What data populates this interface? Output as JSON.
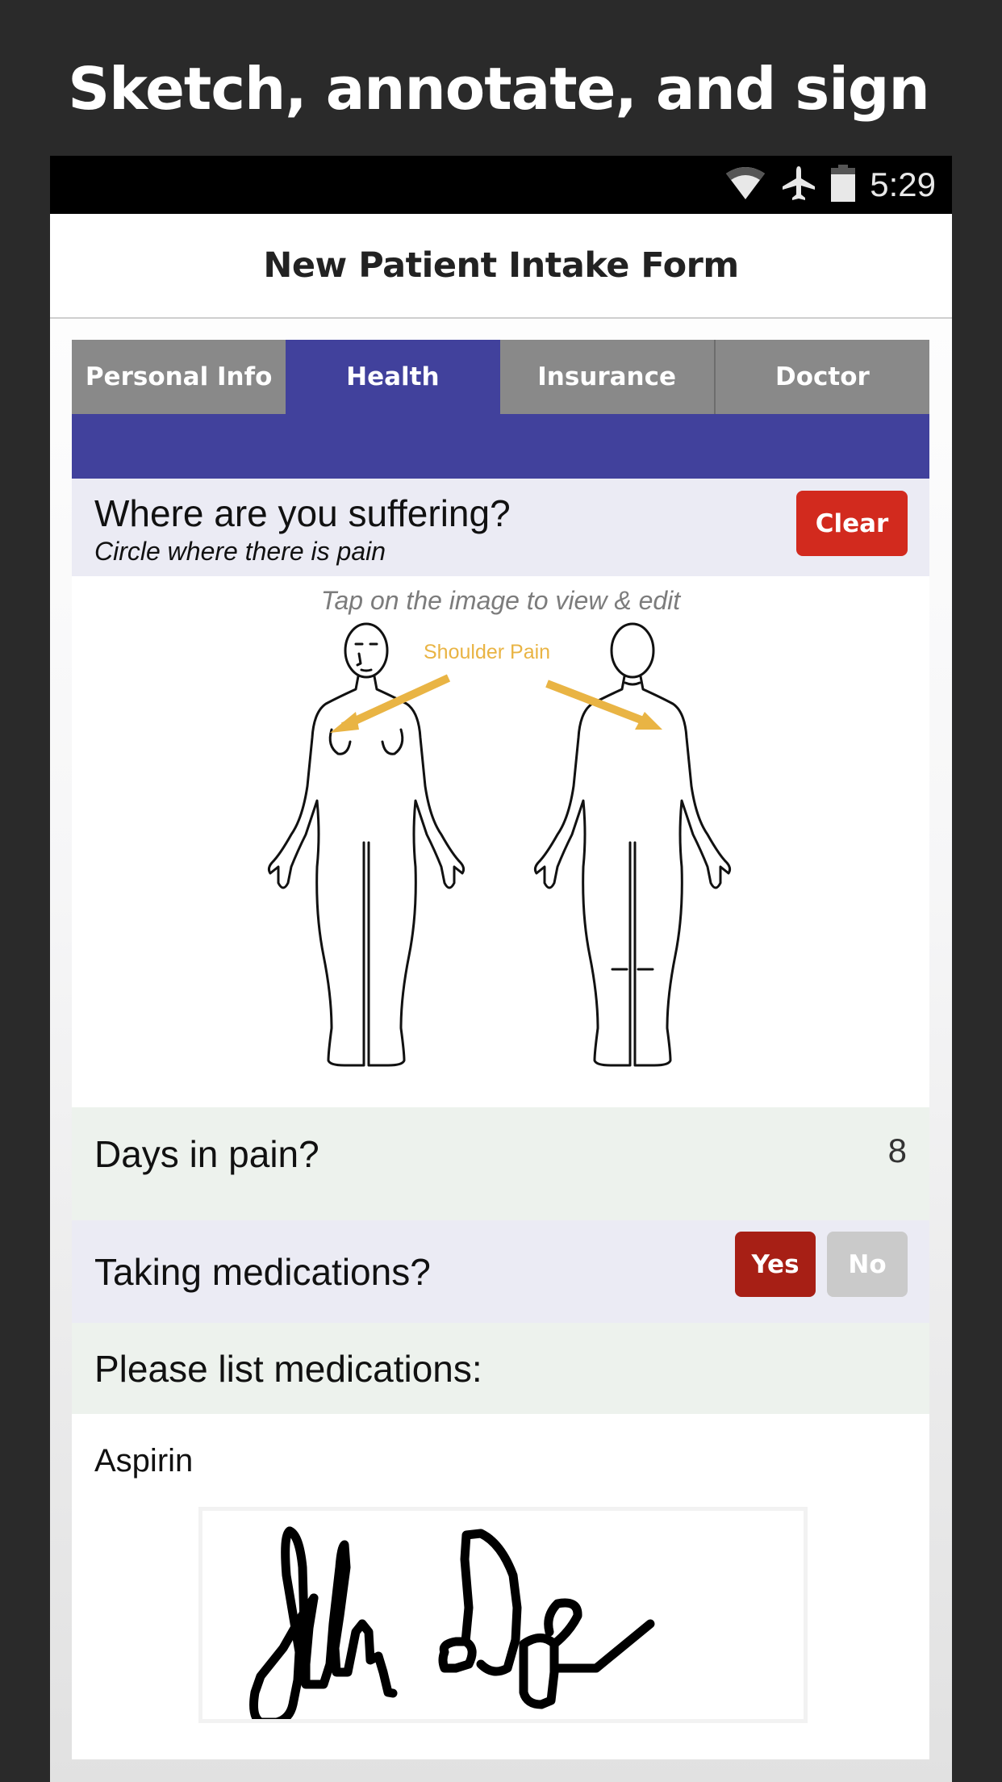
{
  "headline": "Sketch, annotate, and sign",
  "status_bar": {
    "icons": [
      "wifi-icon",
      "airplane-mode-icon",
      "battery-icon"
    ],
    "time": "5:29"
  },
  "nav": {
    "title": "New Patient Intake Form"
  },
  "tabs": [
    {
      "label": "Personal Info",
      "active": false
    },
    {
      "label": "Health",
      "active": true
    },
    {
      "label": "Insurance",
      "active": false
    },
    {
      "label": "Doctor",
      "active": false
    }
  ],
  "pain_section": {
    "title": "Where are you suffering?",
    "subtitle": "Circle where there is pain",
    "clear_label": "Clear",
    "hint": "Tap on the image to view & edit",
    "annotation": "Shoulder Pain"
  },
  "days_in_pain": {
    "label": "Days in pain?",
    "value": "8"
  },
  "medications": {
    "label": "Taking medications?",
    "yes_label": "Yes",
    "no_label": "No",
    "selected": "Yes"
  },
  "medication_list": {
    "label": "Please list medications:",
    "value": "Aspirin"
  },
  "signature": {
    "name": "John Doe"
  },
  "colors": {
    "accent": "#41419c",
    "clear": "#d22a1e",
    "yes_selected": "#a71f15",
    "no_unselected": "#cacaca",
    "annotation": "#e9b444",
    "tab_inactive": "#898989"
  }
}
